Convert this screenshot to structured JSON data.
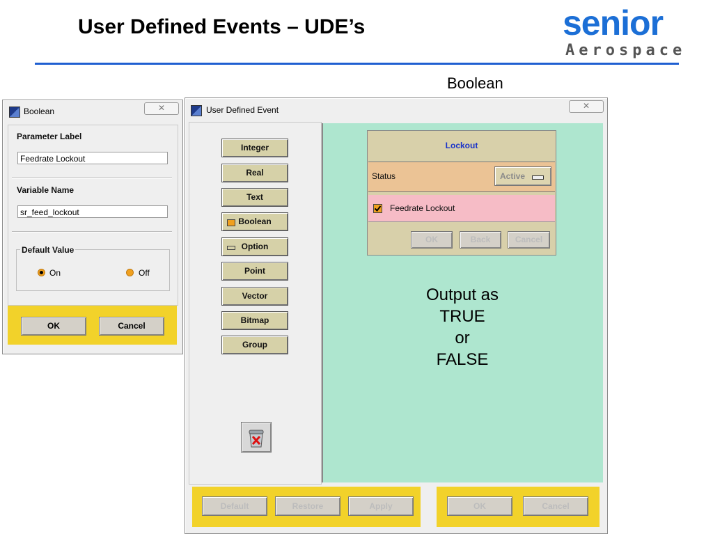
{
  "slide": {
    "title": "User Defined Events – UDE’s",
    "section_label": "Boolean",
    "logo": {
      "top": "senior",
      "bottom": "Aerospace"
    }
  },
  "boolean_dialog": {
    "title": "Boolean",
    "close": "✕",
    "param_label_heading": "Parameter Label",
    "param_label_value": "Feedrate Lockout",
    "variable_name_heading": "Variable Name",
    "variable_name_value": "sr_feed_lockout",
    "default_value_heading": "Default Value",
    "options": [
      {
        "label": "On",
        "selected": true
      },
      {
        "label": "Off",
        "selected": false
      }
    ],
    "ok": "OK",
    "cancel": "Cancel"
  },
  "ude_dialog": {
    "title": "User Defined Event",
    "close": "✕",
    "types": [
      "Integer",
      "Real",
      "Text",
      "Boolean",
      "Option",
      "Point",
      "Vector",
      "Bitmap",
      "Group"
    ],
    "preview": {
      "title": "Lockout",
      "status_label": "Status",
      "status_value": "Active",
      "checkbox_label": "Feedrate Lockout",
      "checkbox_checked": true,
      "ok": "OK",
      "back": "Back",
      "cancel": "Cancel"
    },
    "output_lines": [
      "Output as",
      "TRUE",
      "or",
      "FALSE"
    ],
    "bottom_left_buttons": [
      "Default",
      "Restore",
      "Apply"
    ],
    "bottom_right_buttons": [
      "OK",
      "Cancel"
    ]
  },
  "colors": {
    "accent_blue": "#1f5fd1",
    "panel_mint": "#aee6cf",
    "button_yellow": "#f2d22a",
    "status_tan": "#ebc395",
    "check_pink": "#f6bcc6"
  }
}
